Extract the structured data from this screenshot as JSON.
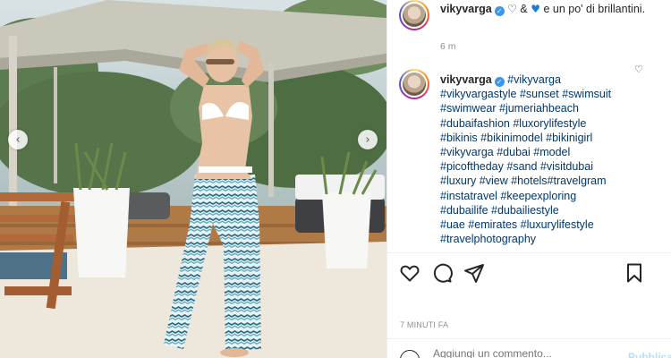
{
  "post": {
    "photo_alt": "",
    "nav_prev_glyph": "‹",
    "nav_next_glyph": "›"
  },
  "caption": {
    "username": "vikyvarga",
    "verified_glyph": "✓",
    "heart_outline": "♡",
    "ampersand": " & ",
    "heart_blue": "♥",
    "text": " e un po' di brillantini.",
    "time": "6 m"
  },
  "comment": {
    "username": "vikyvarga",
    "verified_glyph": "✓",
    "like_glyph": "♡",
    "hashtags": [
      "#vikyvarga",
      "#vikyvargastyle",
      "#sunset",
      "#swimsuit",
      "#swimwear",
      "#jumeriahbeach",
      "#dubaifashion",
      "#luxorylifestyle",
      "#bikinis",
      "#bikinimodel",
      "#bikinigirl",
      "#vikyvarga",
      "#dubai",
      "#model",
      "#picoftheday",
      "#sand",
      "#visitdubai",
      "#luxury",
      "#view",
      "#hotels",
      "#travelgram",
      "#instatravel",
      "#keepexploring",
      "#dubailife",
      "#dubailiestyle",
      "#uae",
      "#emirates",
      "#luxurylifestyle",
      "#travelphotography"
    ]
  },
  "actions": {
    "like": "heart-icon",
    "comment": "comment-icon",
    "share": "share-icon",
    "save": "bookmark-icon"
  },
  "post_date": "7 MINUTI FA",
  "comment_bar": {
    "placeholder": "Aggiungi un commento...",
    "publish_label": "Pubblica"
  },
  "colors": {
    "hashtag": "#00376b",
    "verified": "#3897f0",
    "muted": "#8e8e8e"
  }
}
